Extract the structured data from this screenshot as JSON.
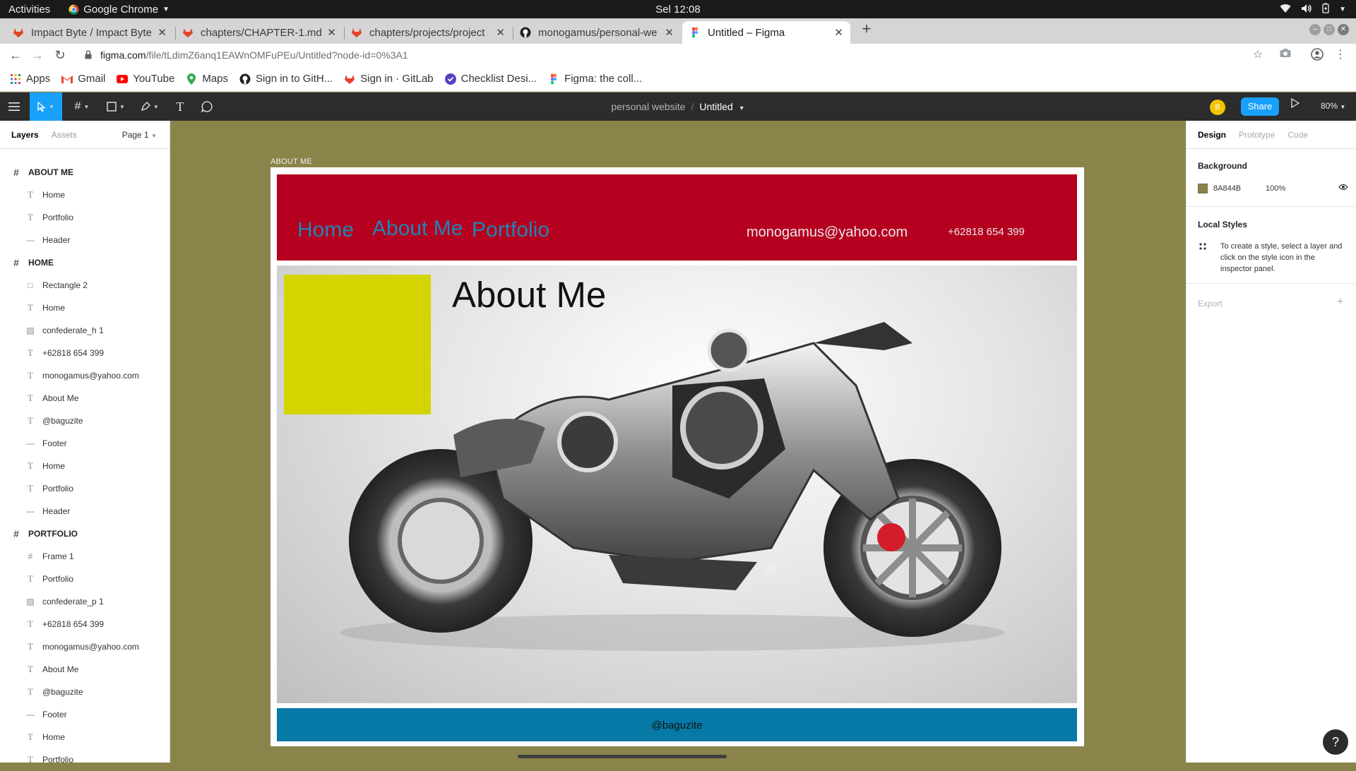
{
  "os": {
    "activities": "Activities",
    "app_name": "Google Chrome",
    "clock": "Sel 12:08"
  },
  "browser": {
    "tabs": [
      {
        "title": "Impact Byte / Impact Byte"
      },
      {
        "title": "chapters/CHAPTER-1.md"
      },
      {
        "title": "chapters/projects/project"
      },
      {
        "title": "monogamus/personal-we"
      },
      {
        "title": "Untitled – Figma"
      }
    ],
    "url_host": "figma.com",
    "url_path": "/file/tLdimZ6anq1EAWnOMFuPEu/Untitled?node-id=0%3A1",
    "bookmarks": [
      {
        "label": "Apps",
        "icon": "apps-grid-icon"
      },
      {
        "label": "Gmail",
        "icon": "gmail-icon"
      },
      {
        "label": "YouTube",
        "icon": "youtube-icon"
      },
      {
        "label": "Maps",
        "icon": "maps-icon"
      },
      {
        "label": "Sign in to GitH...",
        "icon": "github-icon"
      },
      {
        "label": "Sign in · GitLab",
        "icon": "gitlab-icon"
      },
      {
        "label": "Checklist Desi...",
        "icon": "checklist-icon"
      },
      {
        "label": "Figma: the coll...",
        "icon": "figma-icon"
      }
    ]
  },
  "figma": {
    "project": "personal website",
    "file": "Untitled",
    "avatar_letter": "B",
    "share": "Share",
    "zoom": "80%",
    "left_tabs": {
      "layers": "Layers",
      "assets": "Assets",
      "page": "Page 1"
    },
    "layers": [
      {
        "name": "ABOUT ME",
        "kind": "frame"
      },
      {
        "name": "Home",
        "kind": "text"
      },
      {
        "name": "Portfolio",
        "kind": "text"
      },
      {
        "name": "Header",
        "kind": "line"
      },
      {
        "name": "HOME",
        "kind": "frame"
      },
      {
        "name": "Rectangle 2",
        "kind": "rect"
      },
      {
        "name": "Home",
        "kind": "text"
      },
      {
        "name": "confederate_h 1",
        "kind": "image"
      },
      {
        "name": "+62818 654 399",
        "kind": "text"
      },
      {
        "name": "monogamus@yahoo.com",
        "kind": "text"
      },
      {
        "name": "About Me",
        "kind": "text"
      },
      {
        "name": "@baguzite",
        "kind": "text"
      },
      {
        "name": "Footer",
        "kind": "line"
      },
      {
        "name": "Home",
        "kind": "text"
      },
      {
        "name": "Portfolio",
        "kind": "text"
      },
      {
        "name": "Header",
        "kind": "line"
      },
      {
        "name": "PORTFOLIO",
        "kind": "frame"
      },
      {
        "name": "Frame 1",
        "kind": "frame-small"
      },
      {
        "name": "Portfolio",
        "kind": "text"
      },
      {
        "name": "confederate_p 1",
        "kind": "image"
      },
      {
        "name": "+62818 654 399",
        "kind": "text"
      },
      {
        "name": "monogamus@yahoo.com",
        "kind": "text"
      },
      {
        "name": "About Me",
        "kind": "text"
      },
      {
        "name": "@baguzite",
        "kind": "text"
      },
      {
        "name": "Footer",
        "kind": "line"
      },
      {
        "name": "Home",
        "kind": "text"
      },
      {
        "name": "Portfolio",
        "kind": "text"
      }
    ],
    "right_tabs": {
      "design": "Design",
      "prototype": "Prototype",
      "code": "Code"
    },
    "background": {
      "label": "Background",
      "hex": "8A844B",
      "opacity": "100%",
      "color": "#8a844b"
    },
    "local_styles": {
      "label": "Local Styles",
      "hint": "To create a style, select a layer and click on the style icon in the inspector panel."
    },
    "export": "Export"
  },
  "design": {
    "frame_label": "ABOUT ME",
    "nav": {
      "home": "Home",
      "about": "About Me",
      "portfolio": "Portfolio"
    },
    "email": "monogamus@yahoo.com",
    "phone": "+62818 654 399",
    "hero_title": "About Me",
    "footer_handle": "@baguzite",
    "colors": {
      "header": "#b5001f",
      "nav_text": "#1f86b4",
      "footer": "#0779a6",
      "accent_rect": "#d4d400"
    }
  }
}
